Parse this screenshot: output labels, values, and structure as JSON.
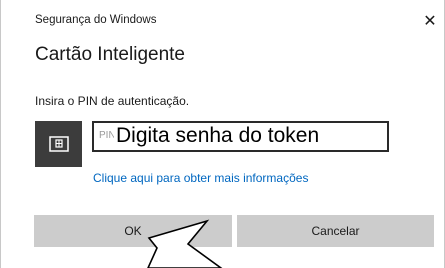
{
  "window": {
    "title": "Segurança do Windows",
    "close_glyph": "✕"
  },
  "dialog": {
    "heading": "Cartão Inteligente",
    "prompt": "Insira o PIN de autenticação.",
    "card_icon": "smart-card-reader-icon",
    "pin_field": {
      "placeholder": "PIN",
      "value": ""
    },
    "annotation": "Digita senha do token",
    "info_link": "Clique aqui para obter mais informações"
  },
  "buttons": {
    "ok_label": "OK",
    "cancel_label": "Cancelar"
  },
  "colors": {
    "link": "#0067c0",
    "button_bg": "#cccccc",
    "tile_bg": "#3c3c3c"
  }
}
